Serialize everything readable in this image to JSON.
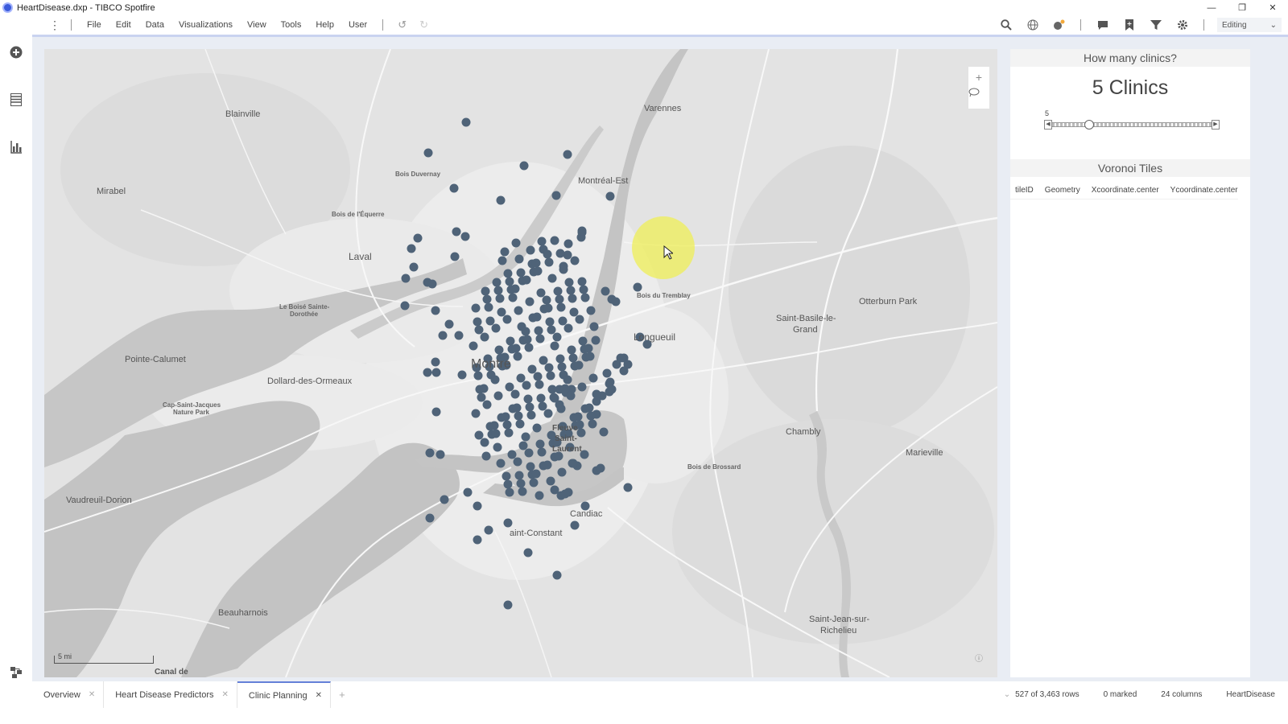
{
  "window": {
    "title": "HeartDisease.dxp - TIBCO Spotfire",
    "controls": [
      "minimize",
      "restore",
      "close"
    ]
  },
  "left_rail": {
    "icons": [
      "add-circle-icon",
      "data-table-icon",
      "bar-chart-icon",
      "data-flow-icon"
    ]
  },
  "menu": {
    "items": [
      "File",
      "Edit",
      "Data",
      "Visualizations",
      "View",
      "Tools",
      "Help",
      "User"
    ]
  },
  "toolbar": {
    "icons": [
      "search-icon",
      "globe-icon",
      "notification-icon",
      "comment-icon",
      "bookmark-icon",
      "filter-icon",
      "gear-icon"
    ],
    "mode": "Editing"
  },
  "map": {
    "places": [
      {
        "name": "Blainville",
        "size": "normal"
      },
      {
        "name": "Varennes",
        "size": "normal"
      },
      {
        "name": "Bois Duvernay",
        "size": "small"
      },
      {
        "name": "Montréal-Est",
        "size": "normal"
      },
      {
        "name": "Mirabel",
        "size": "normal"
      },
      {
        "name": "Bois de l'Équerre",
        "size": "small"
      },
      {
        "name": "Laval",
        "size": "normal"
      },
      {
        "name": "Bois du Tremblay",
        "size": "small"
      },
      {
        "name": "Otterburn Park",
        "size": "normal"
      },
      {
        "name": "Le Boisé Sainte-",
        "size": "small"
      },
      {
        "name": "Dorothée",
        "size": "small"
      },
      {
        "name": "Saint-Basile-le-",
        "size": "normal"
      },
      {
        "name": "Grand",
        "size": "normal"
      },
      {
        "name": "Longueuil",
        "size": "normal"
      },
      {
        "name": "Pointe-Calumet",
        "size": "normal"
      },
      {
        "name": "Montre",
        "size": "big"
      },
      {
        "name": "Dollard-des-Ormeaux",
        "size": "normal"
      },
      {
        "name": "Cap-Saint-Jacques",
        "size": "small"
      },
      {
        "name": "Nature Park",
        "size": "small"
      },
      {
        "name": "Fleuve",
        "size": "normal"
      },
      {
        "name": "Saint-",
        "size": "normal"
      },
      {
        "name": "Laurent",
        "size": "normal"
      },
      {
        "name": "Chambly",
        "size": "normal"
      },
      {
        "name": "Marieville",
        "size": "normal"
      },
      {
        "name": "Bois de Brossard",
        "size": "small"
      },
      {
        "name": "Vaudreuil-Dorion",
        "size": "normal"
      },
      {
        "name": "Candiac",
        "size": "normal"
      },
      {
        "name": "aint-Constant",
        "size": "normal"
      },
      {
        "name": "Beauharnois",
        "size": "normal"
      },
      {
        "name": "Saint-Jean-sur-",
        "size": "normal"
      },
      {
        "name": "Richelieu",
        "size": "normal"
      },
      {
        "name": "Canal de",
        "size": "normal"
      }
    ],
    "scale_label": "5 mi",
    "marker_color": "#4f6378",
    "controls": [
      "zoom-in-icon",
      "lasso-icon",
      "info-icon"
    ]
  },
  "panel": {
    "question": "How many clinics?",
    "answer": "5 Clinics",
    "slider": {
      "min_label": "5",
      "value": 5
    },
    "table_title": "Voronoi Tiles",
    "columns": [
      "tileID",
      "Geometry",
      "Xcoordinate.center",
      "Ycoordinate.center"
    ]
  },
  "tabs": [
    {
      "label": "Overview",
      "active": false
    },
    {
      "label": "Heart Disease Predictors",
      "active": false
    },
    {
      "label": "Clinic Planning",
      "active": true
    }
  ],
  "status": {
    "rows": "527 of 3,463 rows",
    "marked": "0 marked",
    "columns": "24 columns",
    "table": "HeartDisease"
  }
}
